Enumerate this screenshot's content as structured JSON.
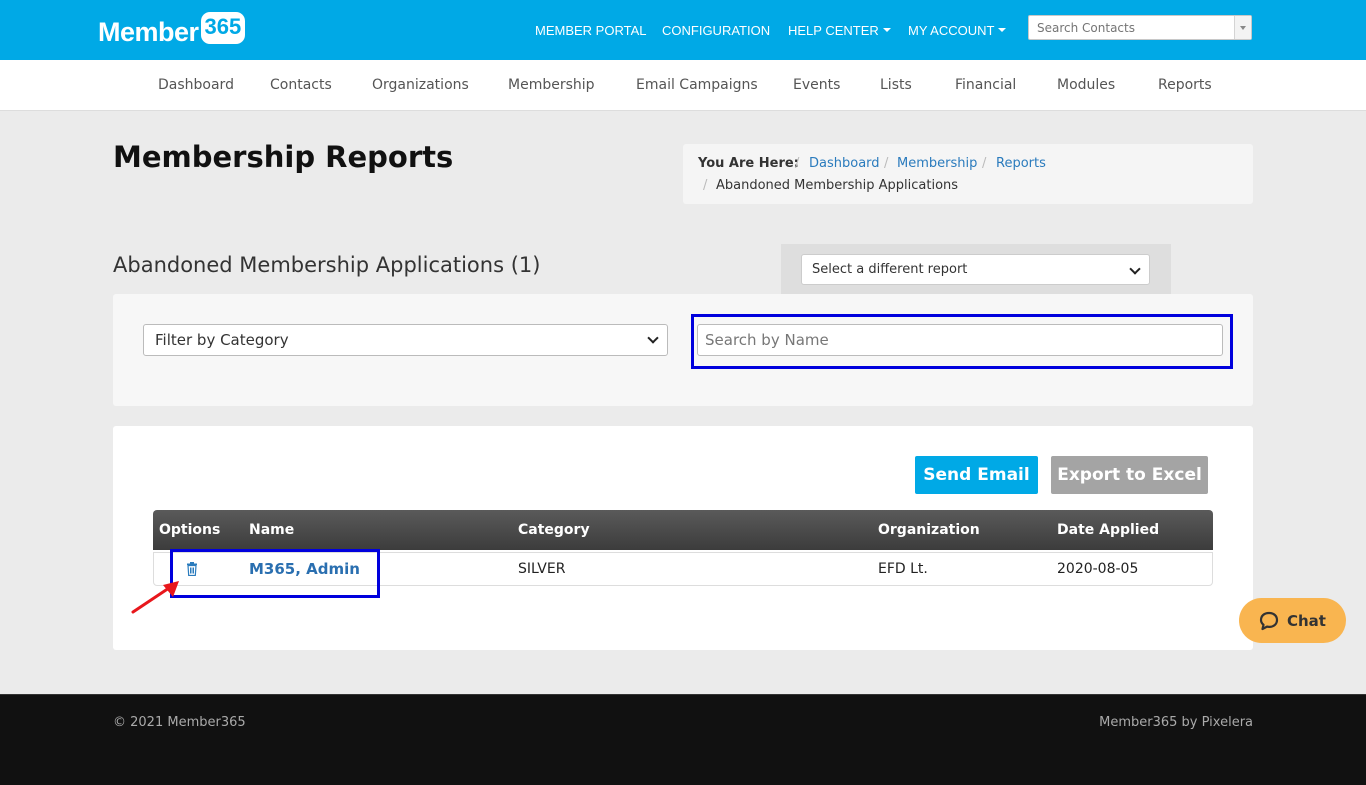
{
  "brand": {
    "logo_text": "Member",
    "logo_badge": "365",
    "primary_color": "#00a9e6"
  },
  "top_nav": {
    "member_portal": "MEMBER PORTAL",
    "configuration": "CONFIGURATION",
    "help_center": "HELP CENTER",
    "my_account": "MY ACCOUNT",
    "search_placeholder": "Search Contacts"
  },
  "main_nav": {
    "items": [
      "Dashboard",
      "Contacts",
      "Organizations",
      "Membership",
      "Email Campaigns",
      "Events",
      "Lists",
      "Financial",
      "Modules",
      "Reports"
    ]
  },
  "page": {
    "title": "Membership Reports"
  },
  "breadcrumb": {
    "label": "You Are Here:",
    "links": [
      "Dashboard",
      "Membership",
      "Reports"
    ],
    "current": "Abandoned Membership Applications"
  },
  "report": {
    "title": "Abandoned Membership Applications (1)",
    "select_label": "Select a different report"
  },
  "filters": {
    "category_label": "Filter by Category",
    "search_placeholder": "Search by Name"
  },
  "actions": {
    "send_email": "Send Email",
    "export_excel": "Export to Excel"
  },
  "table": {
    "columns": [
      "Options",
      "Name",
      "Category",
      "Organization",
      "Date Applied"
    ],
    "rows": [
      {
        "name": "M365, Admin",
        "category": "SILVER",
        "organization": "EFD Lt.",
        "date_applied": "2020-08-05",
        "option_icon": "trash-icon"
      }
    ]
  },
  "chat": {
    "label": "Chat",
    "color": "#f9b550"
  },
  "footer": {
    "copyright": "© 2021 Member365",
    "credit": "Member365 by Pixelera"
  },
  "annotations": {
    "highlight_color": "#0000dd",
    "arrow_color": "#e8171c"
  }
}
